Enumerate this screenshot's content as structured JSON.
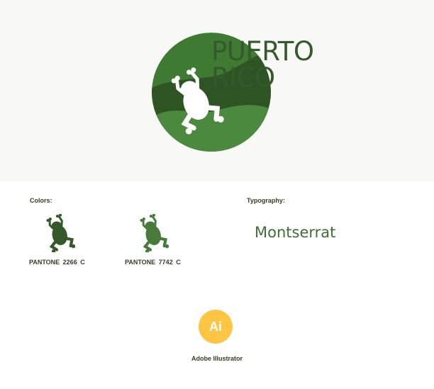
{
  "logo": {
    "line1": "PUERTO",
    "line2": "RICO",
    "text_color": "#35592a",
    "circle_color": "#3f7a33",
    "wave_dark": "#2f5424",
    "wave_light": "#4b8a3e",
    "frog_color": "#ffffff"
  },
  "colors": {
    "heading": "Colors:",
    "swatches": [
      {
        "pantone": "PANTONE  2266 C",
        "hex": "#35592a"
      },
      {
        "pantone": "PANTONE  7742 C",
        "hex": "#477a3b"
      }
    ]
  },
  "typography": {
    "heading": "Typography:",
    "font_name": "Montserrat",
    "font_color": "#3f6e33"
  },
  "software": {
    "badge": "Ai",
    "name": "Adobe Illustrator",
    "badge_color": "#fdc544"
  }
}
